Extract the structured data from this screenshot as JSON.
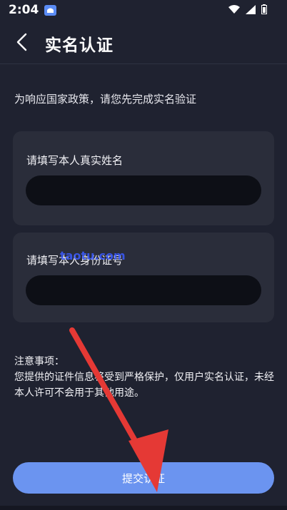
{
  "status_bar": {
    "time": "2:04",
    "icons": [
      "app-icon",
      "wifi-icon",
      "signal-icon",
      "battery-icon"
    ]
  },
  "header": {
    "title": "实名认证",
    "back_icon": "chevron-left-icon"
  },
  "notice": "为响应国家政策，请您先完成实名验证",
  "form": {
    "name": {
      "label": "请填写本人真实姓名",
      "value": ""
    },
    "id_number": {
      "label": "请填写本人身份证号",
      "value": ""
    }
  },
  "notes": {
    "title": "注意事项：",
    "body": "您提供的证件信息将受到严格保护，仅用户实名认证，未经本人许可不会用于其他用途。"
  },
  "submit_label": "提交认证",
  "watermark": "taotu.com",
  "colors": {
    "background": "#1f2230",
    "card": "#2a2d3a",
    "input": "#0d0f16",
    "accent": "#6b94f0",
    "annotation_arrow": "#e53935"
  }
}
